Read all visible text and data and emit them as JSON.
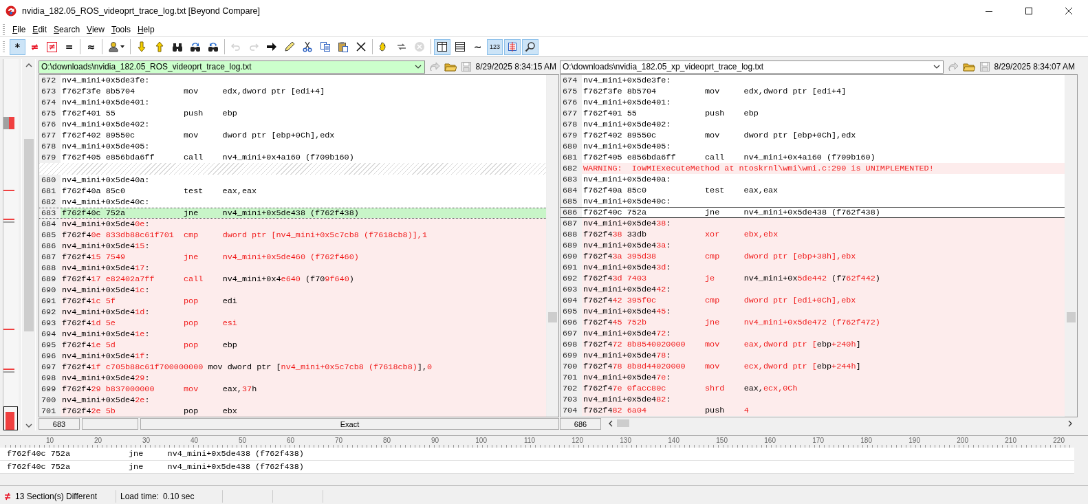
{
  "window": {
    "title": "nvidia_182.05_ROS_videoprt_trace_log.txt  [Beyond Compare]"
  },
  "menu": [
    "File",
    "Edit",
    "Search",
    "View",
    "Tools",
    "Help"
  ],
  "toolbar": [
    [
      {
        "kind": "glyph",
        "label": "*",
        "pressed": true,
        "disabled": false
      },
      {
        "kind": "glyph",
        "label": "≠",
        "color": "#e81123",
        "pressed": false,
        "disabled": false
      },
      {
        "kind": "boxed",
        "label": "≠",
        "color": "#e81123",
        "pressed": false,
        "disabled": false
      },
      {
        "kind": "glyph",
        "label": "=",
        "pressed": false,
        "disabled": false
      }
    ],
    [
      {
        "kind": "glyph",
        "label": "≈",
        "pressed": false,
        "disabled": false
      }
    ],
    [
      {
        "kind": "menu-icon",
        "pressed": false,
        "disabled": false
      }
    ],
    [
      {
        "kind": "icon",
        "pressed": false,
        "disabled": false
      },
      {
        "kind": "icon",
        "pressed": false,
        "disabled": false
      },
      {
        "kind": "icon",
        "pressed": false,
        "disabled": false
      },
      {
        "kind": "icon",
        "pressed": false,
        "disabled": false
      },
      {
        "kind": "icon",
        "pressed": false,
        "disabled": false
      }
    ],
    [
      {
        "kind": "icon",
        "pressed": false,
        "disabled": true
      },
      {
        "kind": "icon",
        "pressed": false,
        "disabled": true
      },
      {
        "kind": "icon",
        "pressed": false,
        "disabled": false
      },
      {
        "kind": "icon",
        "pressed": false,
        "disabled": false
      },
      {
        "kind": "icon",
        "pressed": false,
        "disabled": false
      },
      {
        "kind": "icon",
        "pressed": false,
        "disabled": false
      },
      {
        "kind": "icon",
        "pressed": false,
        "disabled": false
      },
      {
        "kind": "icon",
        "pressed": false,
        "disabled": false
      }
    ],
    [
      {
        "kind": "icon",
        "pressed": false,
        "disabled": false
      },
      {
        "kind": "icon",
        "pressed": false,
        "disabled": false
      },
      {
        "kind": "icon",
        "pressed": false,
        "disabled": true
      }
    ],
    [
      {
        "kind": "icon",
        "pressed": true,
        "disabled": false
      },
      {
        "kind": "icon",
        "pressed": false,
        "disabled": false
      },
      {
        "kind": "glyph",
        "label": "~",
        "pressed": false,
        "disabled": false
      },
      {
        "kind": "small",
        "label": "123",
        "pressed": true,
        "disabled": false
      },
      {
        "kind": "icon",
        "pressed": true,
        "disabled": false
      },
      {
        "kind": "icon",
        "pressed": true,
        "disabled": false
      }
    ]
  ],
  "panes": [
    {
      "path": "O:\\downloads\\nvidia_182.05_ROS_videoprt_trace_log.txt",
      "highlighted": true,
      "timestamp": "8/29/2025 8:34:15 AM",
      "lines": [
        {
          "num": "672",
          "kind": "same",
          "selected": false,
          "parts": [
            {
              "t": "nv4_mini+0x5de3fe:",
              "d": false
            }
          ]
        },
        {
          "num": "673",
          "kind": "same",
          "selected": false,
          "parts": [
            {
              "t": "f762f3fe 8b5704          mov     edx,dword ptr [edi+4]",
              "d": false
            }
          ]
        },
        {
          "num": "674",
          "kind": "same",
          "selected": false,
          "parts": [
            {
              "t": "nv4_mini+0x5de401:",
              "d": false
            }
          ]
        },
        {
          "num": "675",
          "kind": "same",
          "selected": false,
          "parts": [
            {
              "t": "f762f401 55              push    ebp",
              "d": false
            }
          ]
        },
        {
          "num": "676",
          "kind": "same",
          "selected": false,
          "parts": [
            {
              "t": "nv4_mini+0x5de402:",
              "d": false
            }
          ]
        },
        {
          "num": "677",
          "kind": "same",
          "selected": false,
          "parts": [
            {
              "t": "f762f402 89550c          mov     dword ptr [ebp+0Ch],edx",
              "d": false
            }
          ]
        },
        {
          "num": "678",
          "kind": "same",
          "selected": false,
          "parts": [
            {
              "t": "nv4_mini+0x5de405:",
              "d": false
            }
          ]
        },
        {
          "num": "679",
          "kind": "same",
          "selected": false,
          "parts": [
            {
              "t": "f762f405 e856bda6ff      call    nv4_mini+0x4a160 (f709b160)",
              "d": false
            }
          ]
        },
        {
          "kind": "gap",
          "selected": false
        },
        {
          "num": "680",
          "kind": "same",
          "selected": false,
          "parts": [
            {
              "t": "nv4_mini+0x5de40a:",
              "d": false
            }
          ]
        },
        {
          "num": "681",
          "kind": "same",
          "selected": false,
          "parts": [
            {
              "t": "f762f40a 85c0            test    eax,eax",
              "d": false
            }
          ]
        },
        {
          "num": "682",
          "kind": "same",
          "selected": false,
          "parts": [
            {
              "t": "nv4_mini+0x5de40c:",
              "d": false
            }
          ]
        },
        {
          "num": "683",
          "kind": "highlight",
          "selected": true,
          "parts": [
            {
              "t": "f762f40c 752a            jne     nv4_mini+0x5de438 (f762f438)",
              "d": false
            }
          ]
        },
        {
          "num": "684",
          "kind": "changed",
          "selected": false,
          "parts": [
            {
              "t": "nv4_mini+0x5de4",
              "d": false
            },
            {
              "t": "0e",
              "d": true
            },
            {
              "t": ":",
              "d": false
            }
          ]
        },
        {
          "num": "685",
          "kind": "changed",
          "selected": false,
          "parts": [
            {
              "t": "f762f4",
              "d": false
            },
            {
              "t": "0e 833db88c61f701  cmp     dword ptr [nv4_mini+0x5c7cb8 (f7618cb8)],1",
              "d": true
            }
          ]
        },
        {
          "num": "686",
          "kind": "changed",
          "selected": false,
          "parts": [
            {
              "t": "nv4_mini+0x5de4",
              "d": false
            },
            {
              "t": "15",
              "d": true
            },
            {
              "t": ":",
              "d": false
            }
          ]
        },
        {
          "num": "687",
          "kind": "changed",
          "selected": false,
          "parts": [
            {
              "t": "f762f4",
              "d": false
            },
            {
              "t": "15 7549            jne     nv4_mini+0x5de460 (f762f460)",
              "d": true
            }
          ]
        },
        {
          "num": "688",
          "kind": "changed",
          "selected": false,
          "parts": [
            {
              "t": "nv4_mini+0x5de4",
              "d": false
            },
            {
              "t": "17",
              "d": true
            },
            {
              "t": ":",
              "d": false
            }
          ]
        },
        {
          "num": "689",
          "kind": "changed",
          "selected": false,
          "parts": [
            {
              "t": "f762f4",
              "d": false
            },
            {
              "t": "17 e82402a7ff      call",
              "d": true
            },
            {
              "t": "    nv4_mini+0x4",
              "d": false
            },
            {
              "t": "e640",
              "d": true
            },
            {
              "t": " (f70",
              "d": false
            },
            {
              "t": "9f640",
              "d": true
            },
            {
              "t": ")",
              "d": false
            }
          ]
        },
        {
          "num": "690",
          "kind": "changed",
          "selected": false,
          "parts": [
            {
              "t": "nv4_mini+0x5de4",
              "d": false
            },
            {
              "t": "1c",
              "d": true
            },
            {
              "t": ":",
              "d": false
            }
          ]
        },
        {
          "num": "691",
          "kind": "changed",
          "selected": false,
          "parts": [
            {
              "t": "f762f4",
              "d": false
            },
            {
              "t": "1c 5f              pop",
              "d": true
            },
            {
              "t": "     edi",
              "d": false
            }
          ]
        },
        {
          "num": "692",
          "kind": "changed",
          "selected": false,
          "parts": [
            {
              "t": "nv4_mini+0x5de4",
              "d": false
            },
            {
              "t": "1d",
              "d": true
            },
            {
              "t": ":",
              "d": false
            }
          ]
        },
        {
          "num": "693",
          "kind": "changed",
          "selected": false,
          "parts": [
            {
              "t": "f762f4",
              "d": false
            },
            {
              "t": "1d 5e              pop     esi",
              "d": true
            }
          ]
        },
        {
          "num": "694",
          "kind": "changed",
          "selected": false,
          "parts": [
            {
              "t": "nv4_mini+0x5de4",
              "d": false
            },
            {
              "t": "1e",
              "d": true
            },
            {
              "t": ":",
              "d": false
            }
          ]
        },
        {
          "num": "695",
          "kind": "changed",
          "selected": false,
          "parts": [
            {
              "t": "f762f4",
              "d": false
            },
            {
              "t": "1e 5d              pop",
              "d": true
            },
            {
              "t": "     ebp",
              "d": false
            }
          ]
        },
        {
          "num": "696",
          "kind": "changed",
          "selected": false,
          "parts": [
            {
              "t": "nv4_mini+0x5de4",
              "d": false
            },
            {
              "t": "1f",
              "d": true
            },
            {
              "t": ":",
              "d": false
            }
          ]
        },
        {
          "num": "697",
          "kind": "changed",
          "selected": false,
          "parts": [
            {
              "t": "f762f4",
              "d": false
            },
            {
              "t": "1f c705b88c61f700000000",
              "d": true
            },
            {
              "t": " mov dword ptr [",
              "d": false
            },
            {
              "t": "nv4_mini+0x5c7cb8 (f7618cb8)",
              "d": true
            },
            {
              "t": "],",
              "d": false
            },
            {
              "t": "0",
              "d": true
            }
          ]
        },
        {
          "num": "698",
          "kind": "changed",
          "selected": false,
          "parts": [
            {
              "t": "nv4_mini+0x5de4",
              "d": false
            },
            {
              "t": "29",
              "d": true
            },
            {
              "t": ":",
              "d": false
            }
          ]
        },
        {
          "num": "699",
          "kind": "changed",
          "selected": false,
          "parts": [
            {
              "t": "f762f4",
              "d": false
            },
            {
              "t": "29 b837000000      mov",
              "d": true
            },
            {
              "t": "     eax,",
              "d": false
            },
            {
              "t": "37",
              "d": true
            },
            {
              "t": "h",
              "d": false
            }
          ]
        },
        {
          "num": "700",
          "kind": "changed",
          "selected": false,
          "parts": [
            {
              "t": "nv4_mini+0x5de4",
              "d": false
            },
            {
              "t": "2e",
              "d": true
            },
            {
              "t": ":",
              "d": false
            }
          ]
        },
        {
          "num": "701",
          "kind": "changed",
          "selected": false,
          "parts": [
            {
              "t": "f762f4",
              "d": false
            },
            {
              "t": "2e 5b",
              "d": true
            },
            {
              "t": "              pop     ebx",
              "d": false
            }
          ]
        }
      ],
      "footer": {
        "line": "683",
        "mode": "Exact"
      }
    },
    {
      "path": "O:\\downloads\\nvidia_182.05_xp_videoprt_trace_log.txt",
      "highlighted": false,
      "timestamp": "8/29/2025 8:34:07 AM",
      "lines": [
        {
          "num": "674",
          "kind": "same",
          "selected": false,
          "parts": [
            {
              "t": "nv4_mini+0x5de3fe:",
              "d": false
            }
          ]
        },
        {
          "num": "675",
          "kind": "same",
          "selected": false,
          "parts": [
            {
              "t": "f762f3fe 8b5704          mov     edx,dword ptr [edi+4]",
              "d": false
            }
          ]
        },
        {
          "num": "676",
          "kind": "same",
          "selected": false,
          "parts": [
            {
              "t": "nv4_mini+0x5de401:",
              "d": false
            }
          ]
        },
        {
          "num": "677",
          "kind": "same",
          "selected": false,
          "parts": [
            {
              "t": "f762f401 55              push    ebp",
              "d": false
            }
          ]
        },
        {
          "num": "678",
          "kind": "same",
          "selected": false,
          "parts": [
            {
              "t": "nv4_mini+0x5de402:",
              "d": false
            }
          ]
        },
        {
          "num": "679",
          "kind": "same",
          "selected": false,
          "parts": [
            {
              "t": "f762f402 89550c          mov     dword ptr [ebp+0Ch],edx",
              "d": false
            }
          ]
        },
        {
          "num": "680",
          "kind": "same",
          "selected": false,
          "parts": [
            {
              "t": "nv4_mini+0x5de405:",
              "d": false
            }
          ]
        },
        {
          "num": "681",
          "kind": "same",
          "selected": false,
          "parts": [
            {
              "t": "f762f405 e856bda6ff      call    nv4_mini+0x4a160 (f709b160)",
              "d": false
            }
          ]
        },
        {
          "num": "682",
          "kind": "changed",
          "selected": false,
          "parts": [
            {
              "t": "WARNING:  IoWMIExecuteMethod at ntoskrnl\\wmi\\wmi.c:290 is UNIMPLEMENTED!",
              "d": true
            }
          ]
        },
        {
          "num": "683",
          "kind": "same",
          "selected": false,
          "parts": [
            {
              "t": "nv4_mini+0x5de40a:",
              "d": false
            }
          ]
        },
        {
          "num": "684",
          "kind": "same",
          "selected": false,
          "parts": [
            {
              "t": "f762f40a 85c0            test    eax,eax",
              "d": false
            }
          ]
        },
        {
          "num": "685",
          "kind": "same",
          "selected": false,
          "parts": [
            {
              "t": "nv4_mini+0x5de40c:",
              "d": false
            }
          ]
        },
        {
          "num": "686",
          "kind": "same",
          "selected": true,
          "parts": [
            {
              "t": "f762f40c 752a            jne     nv4_mini+0x5de438 (f762f438)",
              "d": false
            }
          ]
        },
        {
          "num": "687",
          "kind": "changed",
          "selected": false,
          "parts": [
            {
              "t": "nv4_mini+0x5de4",
              "d": false
            },
            {
              "t": "38",
              "d": true
            },
            {
              "t": ":",
              "d": false
            }
          ]
        },
        {
          "num": "688",
          "kind": "changed",
          "selected": false,
          "parts": [
            {
              "t": "f762f4",
              "d": false
            },
            {
              "t": "38",
              "d": true
            },
            {
              "t": " 33db            ",
              "d": false
            },
            {
              "t": "xor     ebx,ebx",
              "d": true
            }
          ]
        },
        {
          "num": "689",
          "kind": "changed",
          "selected": false,
          "parts": [
            {
              "t": "nv4_mini+0x5de4",
              "d": false
            },
            {
              "t": "3a",
              "d": true
            },
            {
              "t": ":",
              "d": false
            }
          ]
        },
        {
          "num": "690",
          "kind": "changed",
          "selected": false,
          "parts": [
            {
              "t": "f762f4",
              "d": false
            },
            {
              "t": "3a 395d38          cmp     dword ptr [ebp+38h],ebx",
              "d": true
            }
          ]
        },
        {
          "num": "691",
          "kind": "changed",
          "selected": false,
          "parts": [
            {
              "t": "nv4_mini+0x5de4",
              "d": false
            },
            {
              "t": "3d",
              "d": true
            },
            {
              "t": ":",
              "d": false
            }
          ]
        },
        {
          "num": "692",
          "kind": "changed",
          "selected": false,
          "parts": [
            {
              "t": "f762f4",
              "d": false
            },
            {
              "t": "3d 7403            je",
              "d": true
            },
            {
              "t": "      nv4_mini+0x",
              "d": false
            },
            {
              "t": "5de442",
              "d": true
            },
            {
              "t": " (f7",
              "d": false
            },
            {
              "t": "62f442",
              "d": true
            },
            {
              "t": ")",
              "d": false
            }
          ]
        },
        {
          "num": "693",
          "kind": "changed",
          "selected": false,
          "parts": [
            {
              "t": "nv4_mini+0x5de4",
              "d": false
            },
            {
              "t": "42",
              "d": true
            },
            {
              "t": ":",
              "d": false
            }
          ]
        },
        {
          "num": "694",
          "kind": "changed",
          "selected": false,
          "parts": [
            {
              "t": "f762f4",
              "d": false
            },
            {
              "t": "42 395f0c          cmp     dword ptr [edi+0Ch],ebx",
              "d": true
            }
          ]
        },
        {
          "num": "695",
          "kind": "changed",
          "selected": false,
          "parts": [
            {
              "t": "nv4_mini+0x5de4",
              "d": false
            },
            {
              "t": "45",
              "d": true
            },
            {
              "t": ":",
              "d": false
            }
          ]
        },
        {
          "num": "696",
          "kind": "changed",
          "selected": false,
          "parts": [
            {
              "t": "f762f4",
              "d": false
            },
            {
              "t": "45 752b            jne     nv4_mini+0x5de472 (f762f472)",
              "d": true
            }
          ]
        },
        {
          "num": "697",
          "kind": "changed",
          "selected": false,
          "parts": [
            {
              "t": "nv4_mini+0x5de4",
              "d": false
            },
            {
              "t": "72",
              "d": true
            },
            {
              "t": ":",
              "d": false
            }
          ]
        },
        {
          "num": "698",
          "kind": "changed",
          "selected": false,
          "parts": [
            {
              "t": "f762f4",
              "d": false
            },
            {
              "t": "72 8b8540020000    mov     eax,dword ptr [",
              "d": true
            },
            {
              "t": "ebp",
              "d": false
            },
            {
              "t": "+240h",
              "d": true
            },
            {
              "t": "]",
              "d": false
            }
          ]
        },
        {
          "num": "699",
          "kind": "changed",
          "selected": false,
          "parts": [
            {
              "t": "nv4_mini+0x5de4",
              "d": false
            },
            {
              "t": "78",
              "d": true
            },
            {
              "t": ":",
              "d": false
            }
          ]
        },
        {
          "num": "700",
          "kind": "changed",
          "selected": false,
          "parts": [
            {
              "t": "f762f4",
              "d": false
            },
            {
              "t": "78 8b8d44020000    mov     ecx,dword ptr [",
              "d": true
            },
            {
              "t": "ebp",
              "d": false
            },
            {
              "t": "+244h",
              "d": true
            },
            {
              "t": "]",
              "d": false
            }
          ]
        },
        {
          "num": "701",
          "kind": "changed",
          "selected": false,
          "parts": [
            {
              "t": "nv4_mini+0x5de4",
              "d": false
            },
            {
              "t": "7e",
              "d": true
            },
            {
              "t": ":",
              "d": false
            }
          ]
        },
        {
          "num": "702",
          "kind": "changed",
          "selected": false,
          "parts": [
            {
              "t": "f762f4",
              "d": false
            },
            {
              "t": "7e 0facc80c        shrd",
              "d": true
            },
            {
              "t": "    eax,",
              "d": false
            },
            {
              "t": "ecx,0Ch",
              "d": true
            }
          ]
        },
        {
          "num": "703",
          "kind": "changed",
          "selected": false,
          "parts": [
            {
              "t": "nv4_mini+0x5de4",
              "d": false
            },
            {
              "t": "82",
              "d": true
            },
            {
              "t": ":",
              "d": false
            }
          ]
        },
        {
          "num": "704",
          "kind": "changed",
          "selected": false,
          "parts": [
            {
              "t": "f762f4",
              "d": false
            },
            {
              "t": "82 6a04",
              "d": true
            },
            {
              "t": "            push    ",
              "d": false
            },
            {
              "t": "4",
              "d": true
            }
          ]
        }
      ],
      "footer": {
        "line": "686"
      }
    }
  ],
  "compare_panel": {
    "ruler": [
      "10",
      "20",
      "30",
      "40",
      "50",
      "60",
      "70",
      "80",
      "90",
      "100",
      "110",
      "120",
      "130",
      "140",
      "150",
      "160",
      "170",
      "180",
      "190",
      "200",
      "210",
      "220"
    ],
    "lines": [
      "f762f40c 752a            jne     nv4_mini+0x5de438 (f762f438)",
      "f762f40c 752a            jne     nv4_mini+0x5de438 (f762f438)"
    ]
  },
  "status_bar": {
    "sections": "13 Section(s) Different",
    "load_label": "Load time:",
    "load_time": "0.10 sec"
  }
}
